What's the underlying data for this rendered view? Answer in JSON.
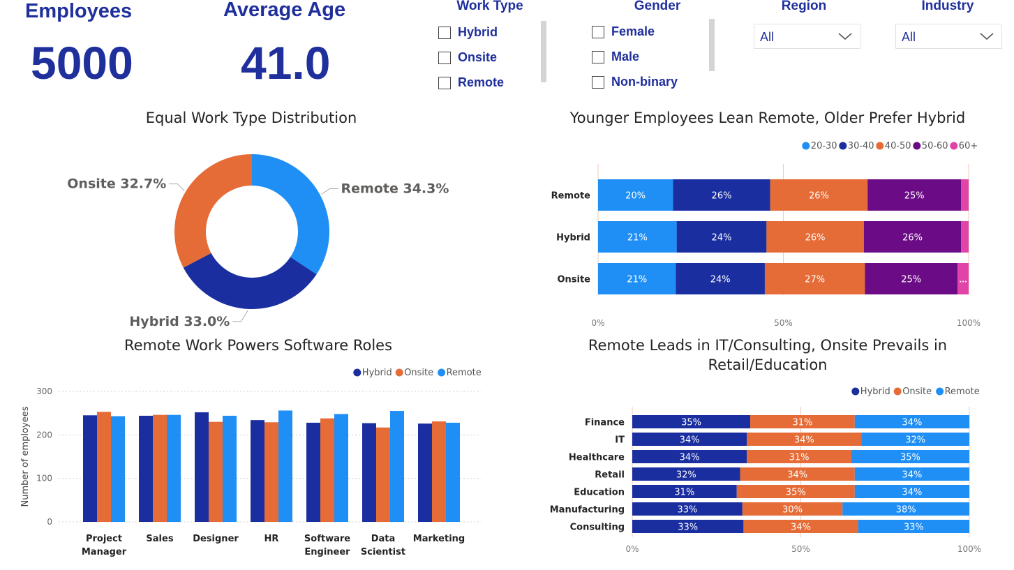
{
  "kpis": {
    "employees_label": "Employees",
    "employees_value": "5000",
    "age_label": "Average Age",
    "age_value": "41.0"
  },
  "slicers": {
    "work_type": {
      "title": "Work Type",
      "options": [
        "Hybrid",
        "Onsite",
        "Remote"
      ]
    },
    "gender": {
      "title": "Gender",
      "options": [
        "Female",
        "Male",
        "Non-binary"
      ]
    },
    "region": {
      "title": "Region",
      "value": "All"
    },
    "industry": {
      "title": "Industry",
      "value": "All"
    }
  },
  "colors": {
    "hybrid": "#1a2ea0",
    "onsite": "#e66c37",
    "remote": "#1f8ff5",
    "age_20_30": "#1f8ff5",
    "age_30_40": "#1a2ea0",
    "age_40_50": "#e66c37",
    "age_50_60": "#6b0c86",
    "age_60_plus": "#e044a7",
    "kpi": "#1f2f9c"
  },
  "donut": {
    "title": "Equal Work Type Distribution",
    "chart_data": {
      "type": "pie",
      "slices": [
        {
          "label": "Remote",
          "value": 34.3,
          "display": "Remote 34.3%"
        },
        {
          "label": "Hybrid",
          "value": 33.0,
          "display": "Hybrid 33.0%"
        },
        {
          "label": "Onsite",
          "value": 32.7,
          "display": "Onsite 32.7%"
        }
      ]
    }
  },
  "age_chart": {
    "title": "Younger Employees Lean Remote, Older Prefer Hybrid",
    "legend": [
      "20-30",
      "30-40",
      "40-50",
      "50-60",
      "60+"
    ],
    "chart_data": {
      "type": "bar",
      "stacked": "100%",
      "categories": [
        "Remote",
        "Hybrid",
        "Onsite"
      ],
      "series": [
        {
          "name": "20-30",
          "values": [
            20,
            21,
            21
          ],
          "labels": [
            "20%",
            "21%",
            "21%"
          ]
        },
        {
          "name": "30-40",
          "values": [
            26,
            24,
            24
          ],
          "labels": [
            "26%",
            "24%",
            "24%"
          ]
        },
        {
          "name": "40-50",
          "values": [
            26,
            26,
            27
          ],
          "labels": [
            "26%",
            "26%",
            "27%"
          ]
        },
        {
          "name": "50-60",
          "values": [
            25,
            26,
            25
          ],
          "labels": [
            "25%",
            "26%",
            "25%"
          ]
        },
        {
          "name": "60+",
          "values": [
            2,
            2,
            3
          ],
          "labels": [
            "",
            "",
            "..."
          ]
        }
      ],
      "ticks": [
        "0%",
        "50%",
        "100%"
      ]
    }
  },
  "roles_chart": {
    "title": "Remote Work Powers Software Roles",
    "ylabel": "Number of employees",
    "legend": [
      "Hybrid",
      "Onsite",
      "Remote"
    ],
    "chart_data": {
      "type": "bar",
      "categories": [
        "Project Manager",
        "Sales",
        "Designer",
        "HR",
        "Software Engineer",
        "Data Scientist",
        "Marketing"
      ],
      "category_lines": [
        [
          "Project",
          "Manager"
        ],
        [
          "Sales"
        ],
        [
          "Designer"
        ],
        [
          "HR"
        ],
        [
          "Software",
          "Engineer"
        ],
        [
          "Data",
          "Scientist"
        ],
        [
          "Marketing"
        ]
      ],
      "series": [
        {
          "name": "Hybrid",
          "values": [
            245,
            244,
            252,
            234,
            228,
            227,
            226
          ]
        },
        {
          "name": "Onsite",
          "values": [
            253,
            246,
            230,
            229,
            238,
            217,
            231
          ]
        },
        {
          "name": "Remote",
          "values": [
            243,
            246,
            244,
            256,
            248,
            255,
            228
          ]
        }
      ],
      "ylim": [
        0,
        300
      ],
      "yticks": [
        "0",
        "100",
        "200",
        "300"
      ]
    }
  },
  "industry_chart": {
    "title_line1": "Remote Leads in IT/Consulting, Onsite Prevails in",
    "title_line2": "Retail/Education",
    "legend": [
      "Hybrid",
      "Onsite",
      "Remote"
    ],
    "chart_data": {
      "type": "bar",
      "stacked": "100%",
      "categories": [
        "Finance",
        "IT",
        "Healthcare",
        "Retail",
        "Education",
        "Manufacturing",
        "Consulting"
      ],
      "series": [
        {
          "name": "Hybrid",
          "values": [
            35,
            34,
            34,
            32,
            31,
            33,
            33
          ]
        },
        {
          "name": "Onsite",
          "values": [
            31,
            34,
            31,
            34,
            35,
            30,
            34
          ]
        },
        {
          "name": "Remote",
          "values": [
            34,
            32,
            35,
            34,
            34,
            38,
            33
          ]
        }
      ],
      "ticks": [
        "0%",
        "50%",
        "100%"
      ]
    }
  }
}
